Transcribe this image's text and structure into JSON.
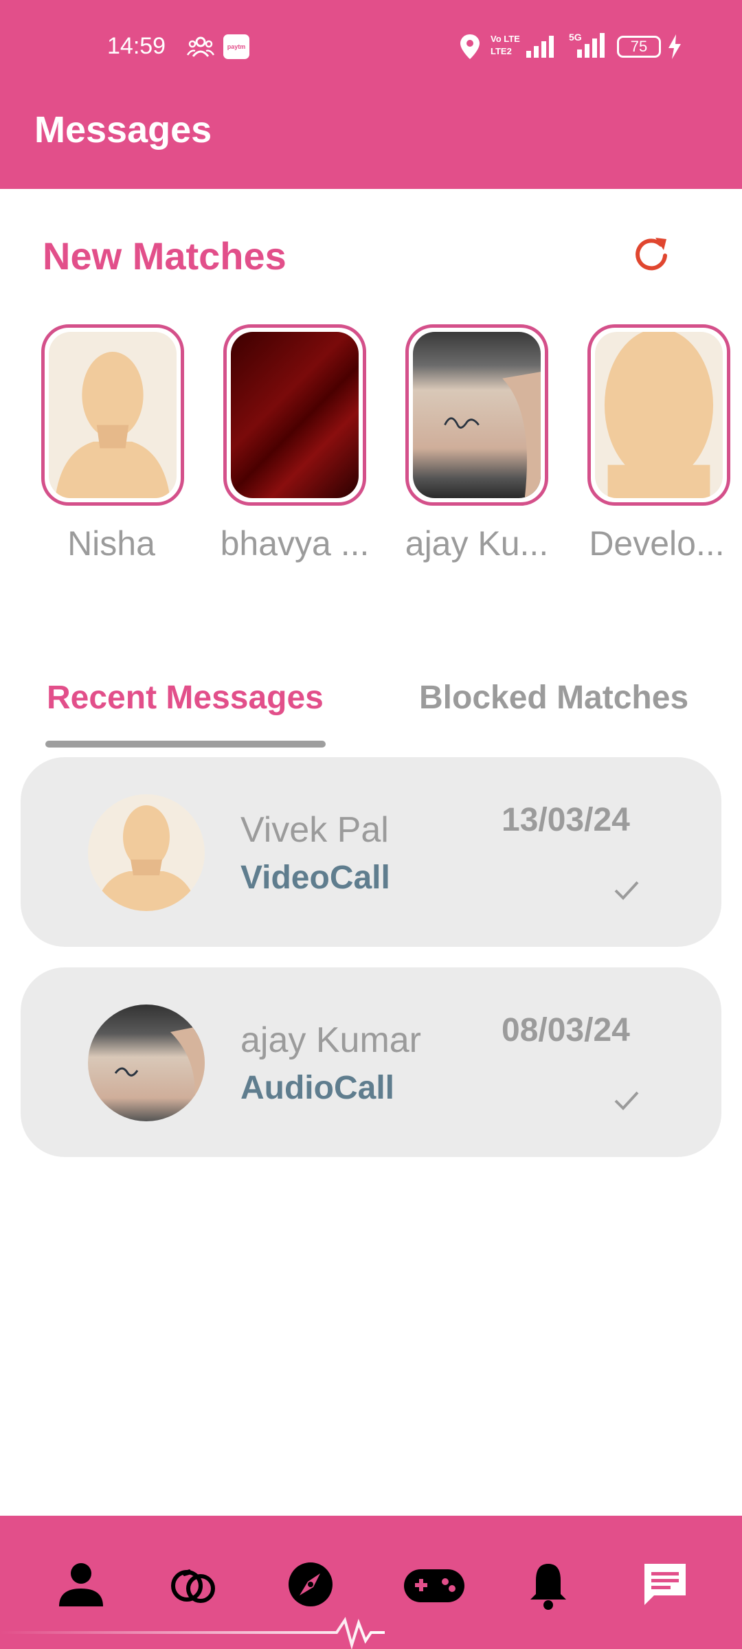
{
  "status": {
    "time": "14:59",
    "paytm_label": "paytm",
    "volte_top": "Vo LTE",
    "volte_bottom": "LTE2",
    "network": "5G",
    "battery": "75"
  },
  "header": {
    "title": "Messages"
  },
  "new_matches": {
    "title": "New Matches",
    "items": [
      {
        "name": "Nisha",
        "photo": "default-avatar"
      },
      {
        "name": "bhavya ...",
        "photo": "dark-red"
      },
      {
        "name": "ajay Ku...",
        "photo": "tattoo-photo"
      },
      {
        "name": "Develo...",
        "photo": "default-avatar"
      }
    ]
  },
  "tabs": {
    "recent": "Recent Messages",
    "blocked": "Blocked Matches"
  },
  "conversations": [
    {
      "name": "Vivek Pal",
      "type": "VideoCall",
      "date": "13/03/24",
      "photo": "default-avatar"
    },
    {
      "name": "ajay Kumar",
      "type": "AudioCall",
      "date": "08/03/24",
      "photo": "tattoo-photo"
    }
  ],
  "bottom_nav": [
    "profile-icon",
    "rings-icon",
    "compass-icon",
    "gamepad-icon",
    "bell-icon",
    "chat-icon"
  ],
  "colors": {
    "brand": "#e24f8a",
    "card": "#ebebeb",
    "accent_refresh": "#e0462f"
  }
}
